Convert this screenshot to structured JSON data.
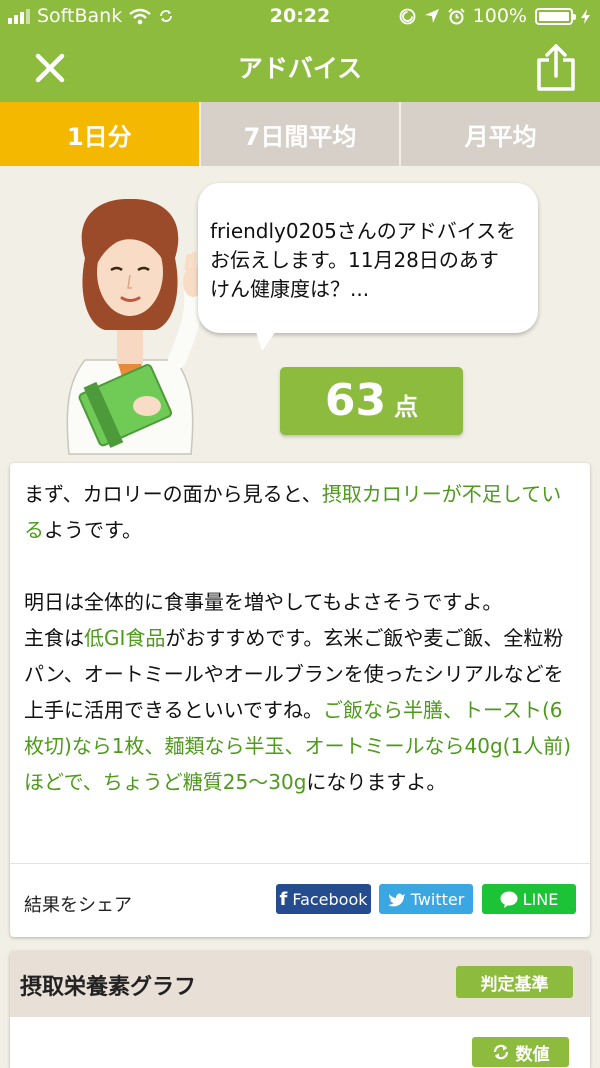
{
  "status_bar": {
    "carrier": "SoftBank",
    "time": "20:22",
    "battery": "100%"
  },
  "header": {
    "title": "アドバイス"
  },
  "tabs": [
    {
      "label": "1日分",
      "active": true
    },
    {
      "label": "7日間平均",
      "active": false
    },
    {
      "label": "月平均",
      "active": false
    }
  ],
  "bubble": {
    "text": "friendly0205さんのアドバイスをお伝えします。11月28日のあすけん健康度は？..."
  },
  "score": {
    "value": "63",
    "unit": "点"
  },
  "advice": {
    "p1": [
      {
        "text": "まず、カロリーの面から見ると、",
        "highlight": false
      },
      {
        "text": "摂取カロリーが不足している",
        "highlight": true
      },
      {
        "text": "ようです。",
        "highlight": false
      }
    ],
    "p2": [
      {
        "text": "明日は全体的に食事量を増やしてもよさそうですよ。",
        "highlight": false
      }
    ],
    "p3": [
      {
        "text": "主食は",
        "highlight": false
      },
      {
        "text": "低GI食品",
        "highlight": true
      },
      {
        "text": "がおすすめです。玄米ご飯や麦ご飯、全粒粉パン、オートミールやオールブランを使ったシリアルなどを上手に活用できるといいですね。",
        "highlight": false
      },
      {
        "text": "ご飯なら半膳、トースト(6枚切)なら1枚、麺類なら半玉、オートミールなら40g(1人前)ほどで、ちょうど糖質25〜30g",
        "highlight": true
      },
      {
        "text": "になりますよ。",
        "highlight": false
      }
    ]
  },
  "share": {
    "label": "結果をシェア",
    "facebook": "Facebook",
    "twitter": "Twitter",
    "line": "LINE"
  },
  "nutrients": {
    "title": "摂取栄養素グラフ",
    "criteria_button": "判定基準",
    "value_button": "数値"
  },
  "colors": {
    "header_green": "#8dbb3e",
    "active_tab": "#f5b800",
    "highlight_text": "#4e9a1c",
    "facebook": "#254c8e",
    "twitter": "#3aa7e3",
    "line": "#1dc337"
  },
  "icons": [
    "signal-icon",
    "wifi-icon",
    "sync-icon",
    "location-icon",
    "alarm-icon",
    "battery-icon",
    "close-icon",
    "share-icon",
    "twitter-bird-icon",
    "line-bubble-icon",
    "refresh-icon"
  ]
}
